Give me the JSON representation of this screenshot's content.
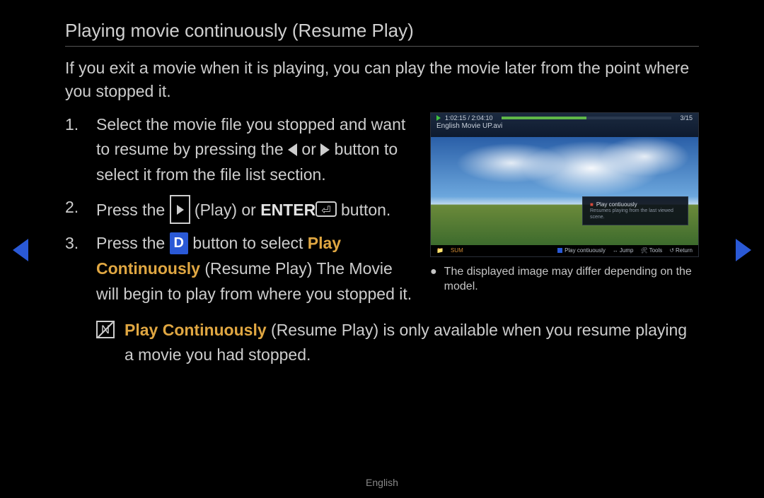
{
  "title": "Playing movie continuously (Resume Play)",
  "intro": "If you exit a movie when it is playing, you can play the movie later from the point where you stopped it.",
  "steps": {
    "s1a": "Select the movie file you stopped and want to resume by pressing the ",
    "s1b": " or ",
    "s1c": " button to select it from the file list section.",
    "s2a": "Press the ",
    "s2b": " (Play) or ",
    "s2enter": "ENTER",
    "s2c": " button.",
    "s3a": "Press the ",
    "s3d": "D",
    "s3b": " button to select ",
    "s3pc": "Play Continuously",
    "s3c": " (Resume Play) The Movie will begin to play from where you stopped it."
  },
  "note": {
    "pc": "Play Continuously",
    "text": " (Resume Play) is only available when you resume playing a movie you had stopped."
  },
  "screenshot": {
    "time": "1:02:15 / 2:04:10",
    "counter": "3/15",
    "movie_title": "English Movie UP.avi",
    "popup_title": "Play contiuously",
    "popup_sub": "Resumes playing from the last viewed scene.",
    "sum": "SUM",
    "foot_play": "Play contiuously",
    "foot_jump": "Jump",
    "foot_tools": "Tools",
    "foot_return": "Return"
  },
  "caption": "The displayed image may differ depending on the model.",
  "language": "English"
}
